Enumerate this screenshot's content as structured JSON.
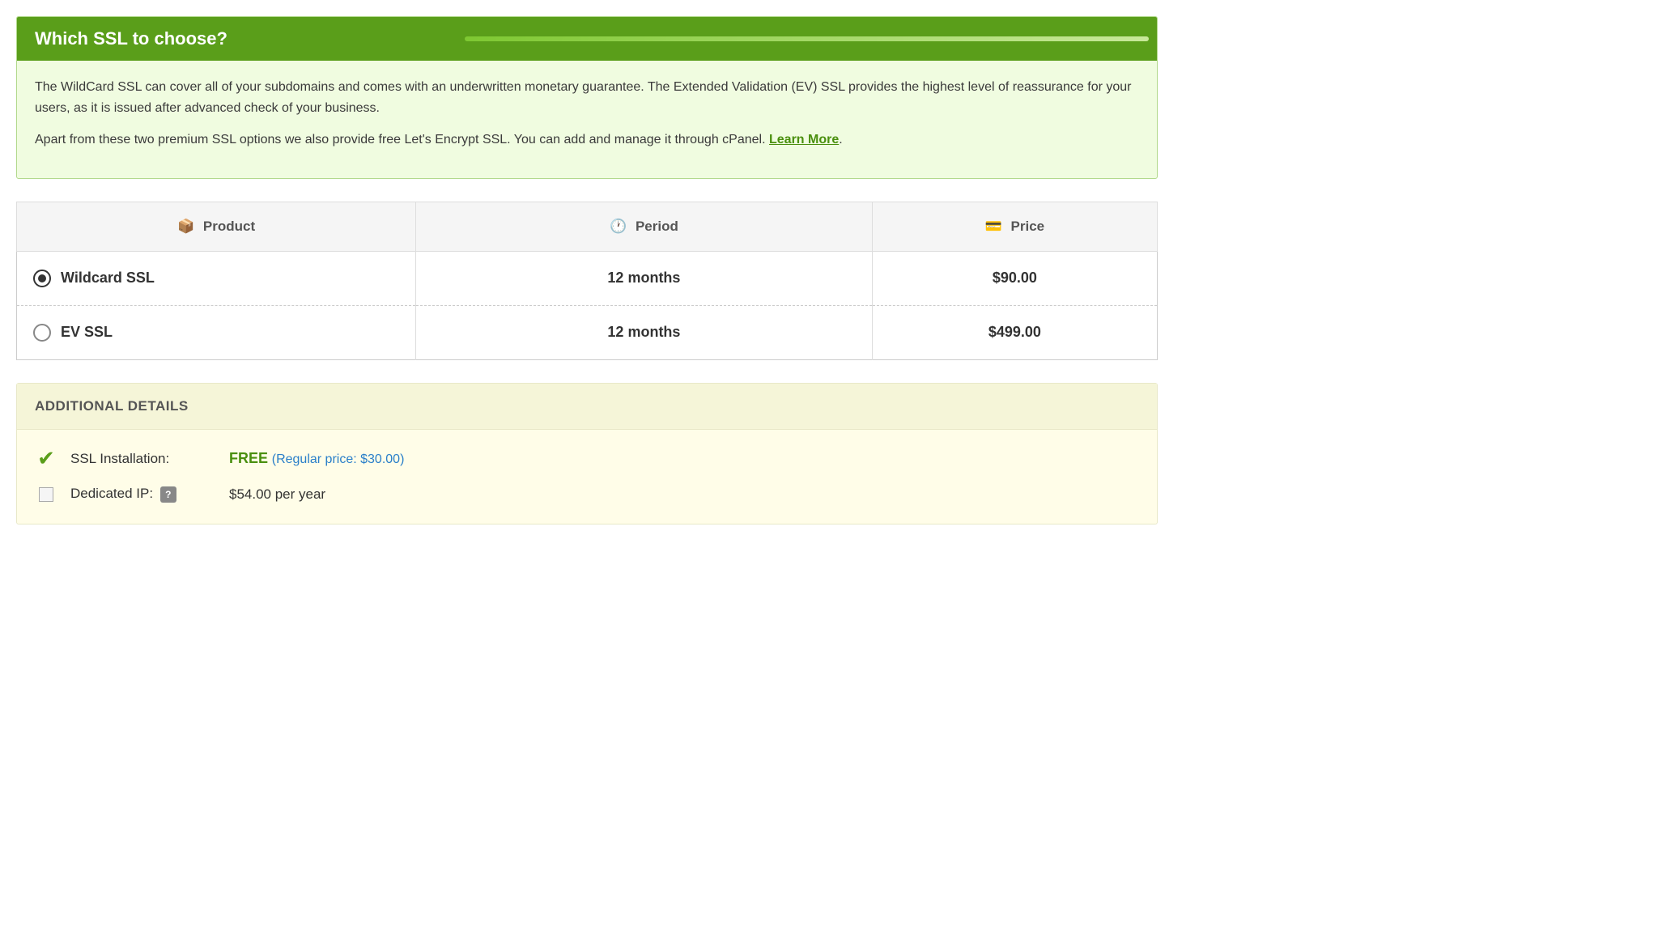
{
  "info_box": {
    "title": "Which SSL to choose?",
    "paragraph1": "The WildCard SSL can cover all of your subdomains and comes with an underwritten monetary guarantee. The Extended Validation (EV) SSL provides the highest level of reassurance for your users, as it is issued after advanced check of your business.",
    "paragraph2": "Apart from these two premium SSL options we also provide free Let's Encrypt SSL. You can add and manage it through cPanel.",
    "learn_more_label": "Learn More"
  },
  "table": {
    "headers": [
      {
        "label": "Product",
        "icon": "📦"
      },
      {
        "label": "Period",
        "icon": "🕐"
      },
      {
        "label": "Price",
        "icon": "💳"
      }
    ],
    "rows": [
      {
        "product": "Wildcard SSL",
        "period": "12 months",
        "price": "$90.00",
        "selected": true
      },
      {
        "product": "EV SSL",
        "period": "12 months",
        "price": "$499.00",
        "selected": false
      }
    ]
  },
  "additional_details": {
    "header": "ADDITIONAL DETAILS",
    "items": [
      {
        "type": "check",
        "label": "SSL Installation:",
        "value_free": "FREE",
        "value_regular": "(Regular price: $30.00)"
      },
      {
        "type": "checkbox",
        "label": "Dedicated IP:",
        "value": "$54.00 per year",
        "has_help": true
      }
    ]
  }
}
